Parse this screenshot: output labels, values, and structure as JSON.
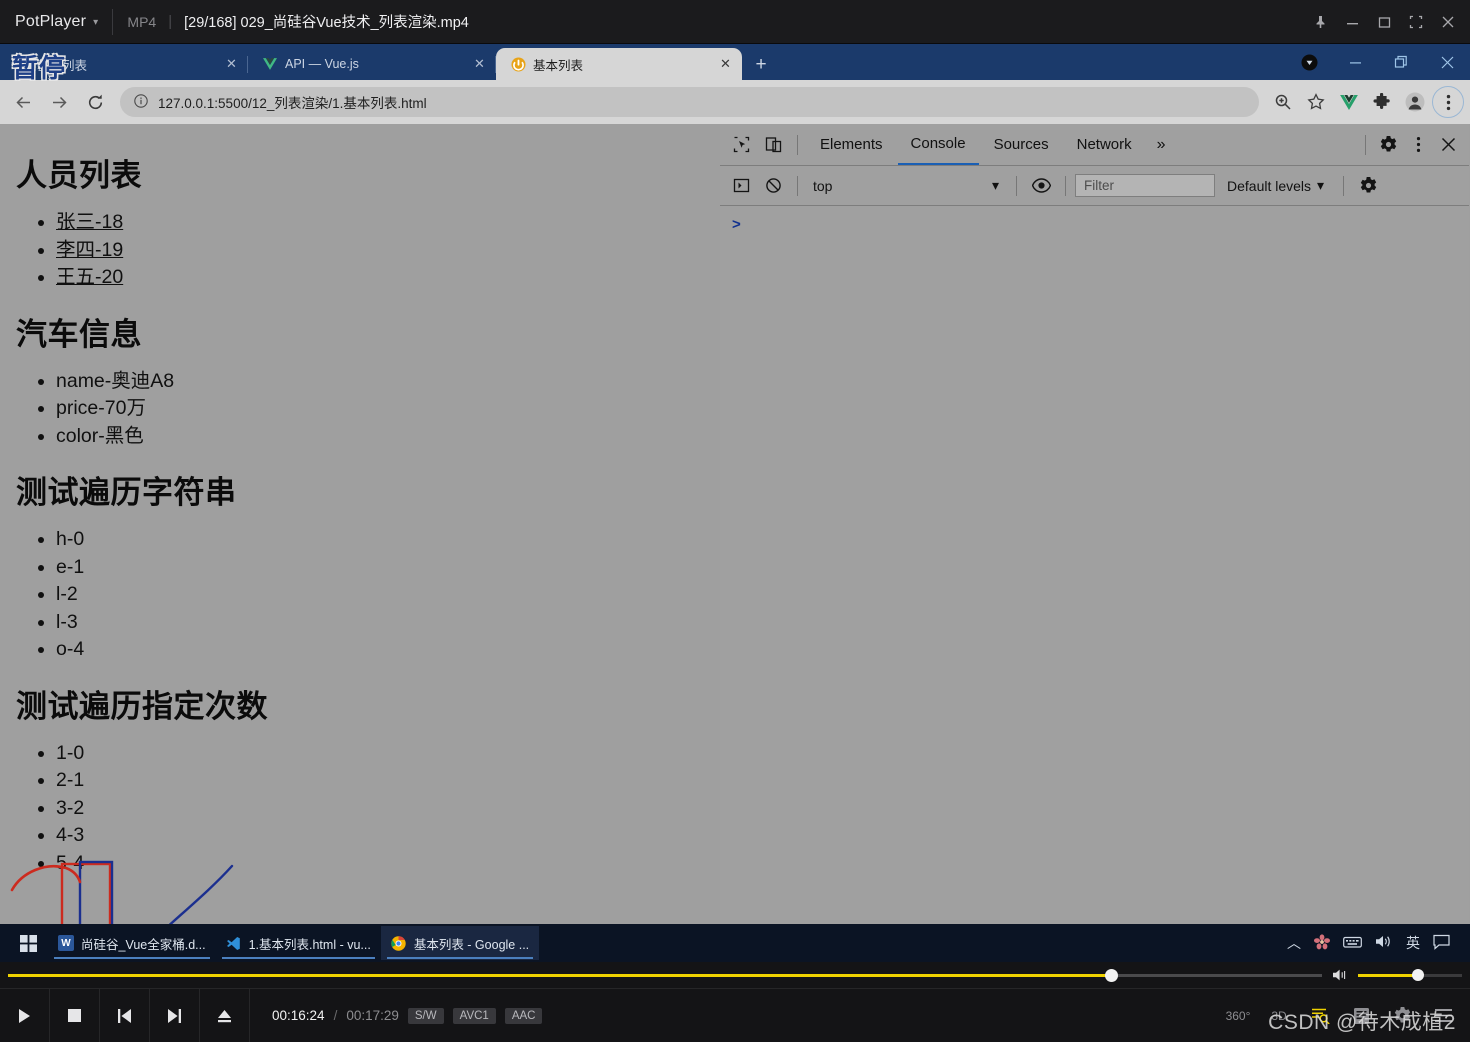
{
  "player": {
    "app_name": "PotPlayer",
    "format_badge": "MP4",
    "file_title": "[29/168] 029_尚硅谷Vue技术_列表渲染.mp4",
    "window_buttons": [
      "pin-icon",
      "minimize-icon",
      "maximize-icon",
      "fullscreen-icon",
      "close-icon"
    ],
    "pause_overlay": "暂停",
    "time_current": "00:16:24",
    "time_separator": "/",
    "time_total": "00:17:29",
    "badges": [
      "S/W",
      "AVC1",
      "AAC"
    ],
    "seek_percent": 84,
    "volume_percent": 58,
    "right_controls": [
      "360°",
      "3D"
    ],
    "watermark": "CSDN @待木成植2"
  },
  "browser": {
    "tabs": [
      {
        "title": "基本列表",
        "favicon": "vue-icon",
        "active": false
      },
      {
        "title": "API — Vue.js",
        "favicon": "vue-icon",
        "active": false
      },
      {
        "title": "基本列表",
        "favicon": "live-server-icon",
        "active": true
      }
    ],
    "new_tab_label": "+",
    "window_buttons": [
      "record-icon",
      "minimize-icon",
      "restore-icon",
      "close-icon"
    ],
    "nav": {
      "back": "←",
      "forward": "→",
      "reload": "⟳"
    },
    "omnibox": {
      "site_info_icon": "info-icon",
      "url": "127.0.0.1:5500/12_列表渲染/1.基本列表.html"
    },
    "toolbar_right": [
      "zoom-icon",
      "bookmark-star-icon",
      "vue-devtools-icon",
      "extensions-icon",
      "profile-icon",
      "chrome-menu-icon"
    ]
  },
  "page": {
    "background": "#9f9f9f",
    "sections": [
      {
        "heading": "人员列表",
        "items": [
          "张三-18",
          "李四-19",
          "王五-20"
        ],
        "underline": true
      },
      {
        "heading": "汽车信息",
        "items": [
          "name-奥迪A8",
          "price-70万",
          "color-黑色"
        ],
        "underline": false
      },
      {
        "heading": "测试遍历字符串",
        "items": [
          "h-0",
          "e-1",
          "l-2",
          "l-3",
          "o-4"
        ],
        "underline": false
      },
      {
        "heading": "测试遍历指定次数",
        "items": [
          "1-0",
          "2-1",
          "3-2",
          "4-3",
          "5-4"
        ],
        "underline": false
      }
    ],
    "annotations": {
      "red_box_color": "#cc2b1f",
      "blue_box_color": "#1b2f8f",
      "red_curve": "arc-over-first-column",
      "blue_arrow": "arrow-pointing-left-down"
    }
  },
  "devtools": {
    "tabs": [
      "Elements",
      "Console",
      "Sources",
      "Network"
    ],
    "active_tab": "Console",
    "overflow_label": "»",
    "left_icons": [
      "inspect-icon",
      "device-toolbar-icon"
    ],
    "right_icons": [
      "settings-gear-icon",
      "more-options-icon",
      "close-devtools-icon"
    ],
    "console_toolbar": {
      "sidebar_toggle": "console-sidebar-icon",
      "clear": "clear-console-icon",
      "context": "top",
      "eye_icon": "live-expression-icon",
      "filter_placeholder": "Filter",
      "levels": "Default levels",
      "settings": "settings-gear-icon"
    },
    "prompt": ">"
  },
  "taskbar": {
    "start_icon": "windows-start-icon",
    "tasks": [
      {
        "label": "尚硅谷_Vue全家桶.d...",
        "icon": "word-icon",
        "icon_color": "#2b579a",
        "icon_text": "W"
      },
      {
        "label": "1.基本列表.html - vu...",
        "icon": "vscode-icon",
        "icon_color": "#1b5e9e",
        "icon_text": ""
      },
      {
        "label": "基本列表 - Google ...",
        "icon": "chrome-icon",
        "icon_color": "#e8b200",
        "icon_text": ""
      }
    ],
    "tray": [
      "chevron-up-icon",
      "sogou-flower-icon",
      "keyboard-icon",
      "volume-icon",
      "英",
      "notification-icon"
    ]
  }
}
